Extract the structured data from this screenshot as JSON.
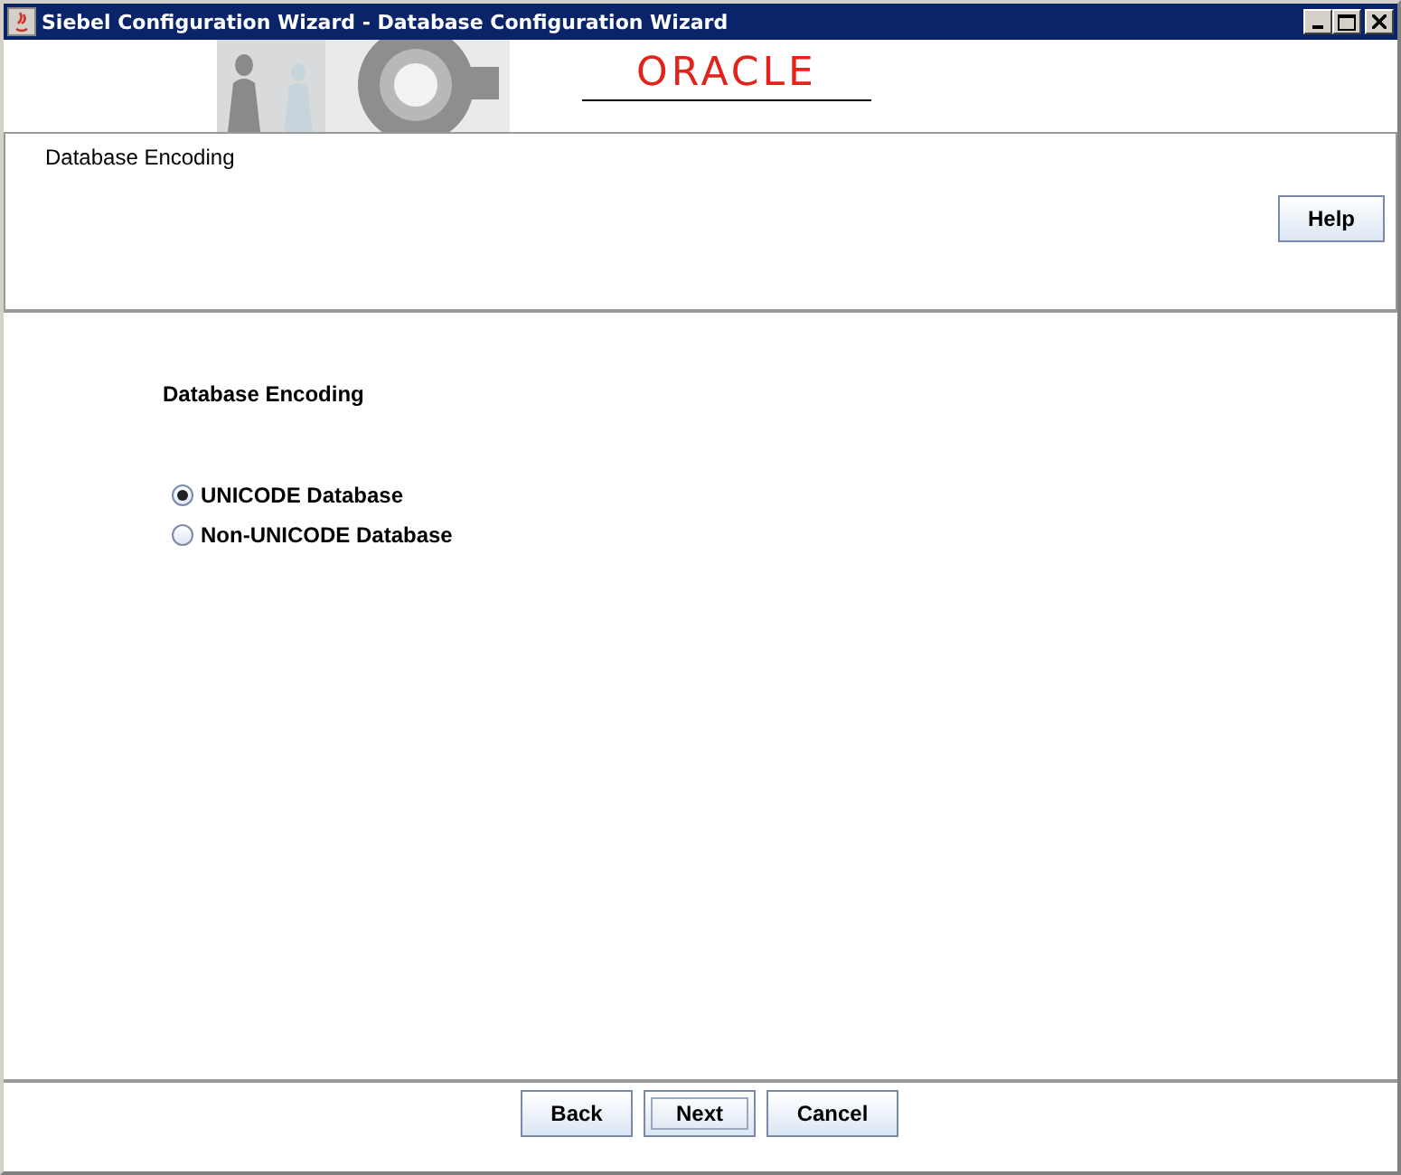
{
  "window": {
    "title": "Siebel Configuration Wizard - Database Configuration Wizard"
  },
  "banner": {
    "logo": "ORACLE"
  },
  "header": {
    "title": "Database Encoding",
    "help_button": "Help"
  },
  "content": {
    "heading": "Database Encoding",
    "options": [
      {
        "label": "UNICODE Database",
        "selected": true
      },
      {
        "label": "Non-UNICODE Database",
        "selected": false
      }
    ]
  },
  "buttons": [
    {
      "label": "Back",
      "focused": false
    },
    {
      "label": "Next",
      "focused": true
    },
    {
      "label": "Cancel",
      "focused": false
    }
  ]
}
